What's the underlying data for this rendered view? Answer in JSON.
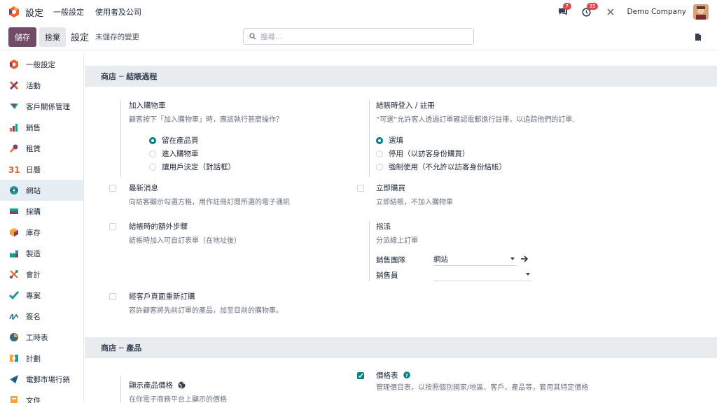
{
  "topbar": {
    "app_title": "設定",
    "menu": [
      "一般設定",
      "使用者及公司"
    ],
    "messages_count": "7",
    "activities_count": "35",
    "company": "Demo Company"
  },
  "control": {
    "save": "儲存",
    "discard": "捨棄",
    "title": "設定",
    "unsaved": "未儲存的變更",
    "search_placeholder": "搜尋..."
  },
  "sidebar": {
    "items": [
      {
        "label": "一般設定",
        "icon": "settings-logo-icon"
      },
      {
        "label": "活動",
        "icon": "event-icon"
      },
      {
        "label": "客戶關係管理",
        "icon": "crm-icon"
      },
      {
        "label": "銷售",
        "icon": "sales-icon"
      },
      {
        "label": "租賃",
        "icon": "rental-icon"
      },
      {
        "label": "日曆",
        "icon": "calendar-icon"
      },
      {
        "label": "網站",
        "icon": "website-icon",
        "active": true
      },
      {
        "label": "採購",
        "icon": "purchase-icon"
      },
      {
        "label": "庫存",
        "icon": "inventory-icon"
      },
      {
        "label": "製造",
        "icon": "manufacturing-icon"
      },
      {
        "label": "會計",
        "icon": "accounting-icon"
      },
      {
        "label": "專案",
        "icon": "project-icon"
      },
      {
        "label": "簽名",
        "icon": "sign-icon"
      },
      {
        "label": "工時表",
        "icon": "timesheet-icon"
      },
      {
        "label": "計劃",
        "icon": "planning-icon"
      },
      {
        "label": "電郵市場行銷",
        "icon": "email-marketing-icon"
      },
      {
        "label": "文件",
        "icon": "documents-icon"
      }
    ]
  },
  "sections": {
    "checkout": "商店 ─ 結賬過程",
    "products": "商店 ─ 產品"
  },
  "settings": {
    "add_to_cart": {
      "title": "加入購物車",
      "desc": "顧客按下「加入購物車」時，應該執行甚麼操作？",
      "options": [
        "留在產品頁",
        "進入購物車",
        "讓用戶決定（對話框）"
      ],
      "selected": 0
    },
    "signin": {
      "title": "結賬時登入 / 註冊",
      "desc": "“可選”允許客人透過訂單確認電郵進行註冊，以追踪他們的訂單.",
      "options": [
        "選填",
        "停用（以訪客身份購買）",
        "強制使用（不允許以訪客身份結賬）"
      ],
      "selected": 0
    },
    "newsletter": {
      "title": "最新消息",
      "desc": "向訪客顯示勾選方格，用作註冊訂閱所選的電子通訊",
      "checked": false
    },
    "buy_now": {
      "title": "立即購買",
      "desc": "立即結賬，不加入購物車",
      "checked": false
    },
    "extra_step": {
      "title": "結帳時的額外步驟",
      "desc": "結帳時加入可自訂表單（在地址後）",
      "checked": false
    },
    "assignment": {
      "title": "指派",
      "desc": "分派線上訂單",
      "team_label": "銷售團隊",
      "team_value": "網站",
      "person_label": "銷售員",
      "person_value": ""
    },
    "reorder": {
      "title": "經客戶頁面重新訂購",
      "desc": "容許顧客將先前訂單的產品，加至目前的購物車。",
      "checked": false
    },
    "product_prices": {
      "title": "顯示產品價格",
      "desc": "在你電子商務平台上顯示的價格"
    },
    "pricelists": {
      "title": "價格表",
      "desc": "管理價目表，以按照個別國家/地區、客戶、產品等，套用其特定價格",
      "checked": true
    }
  },
  "colors": {
    "brand": "#714b67",
    "accent": "#017e84",
    "badge": "#e0464e"
  }
}
